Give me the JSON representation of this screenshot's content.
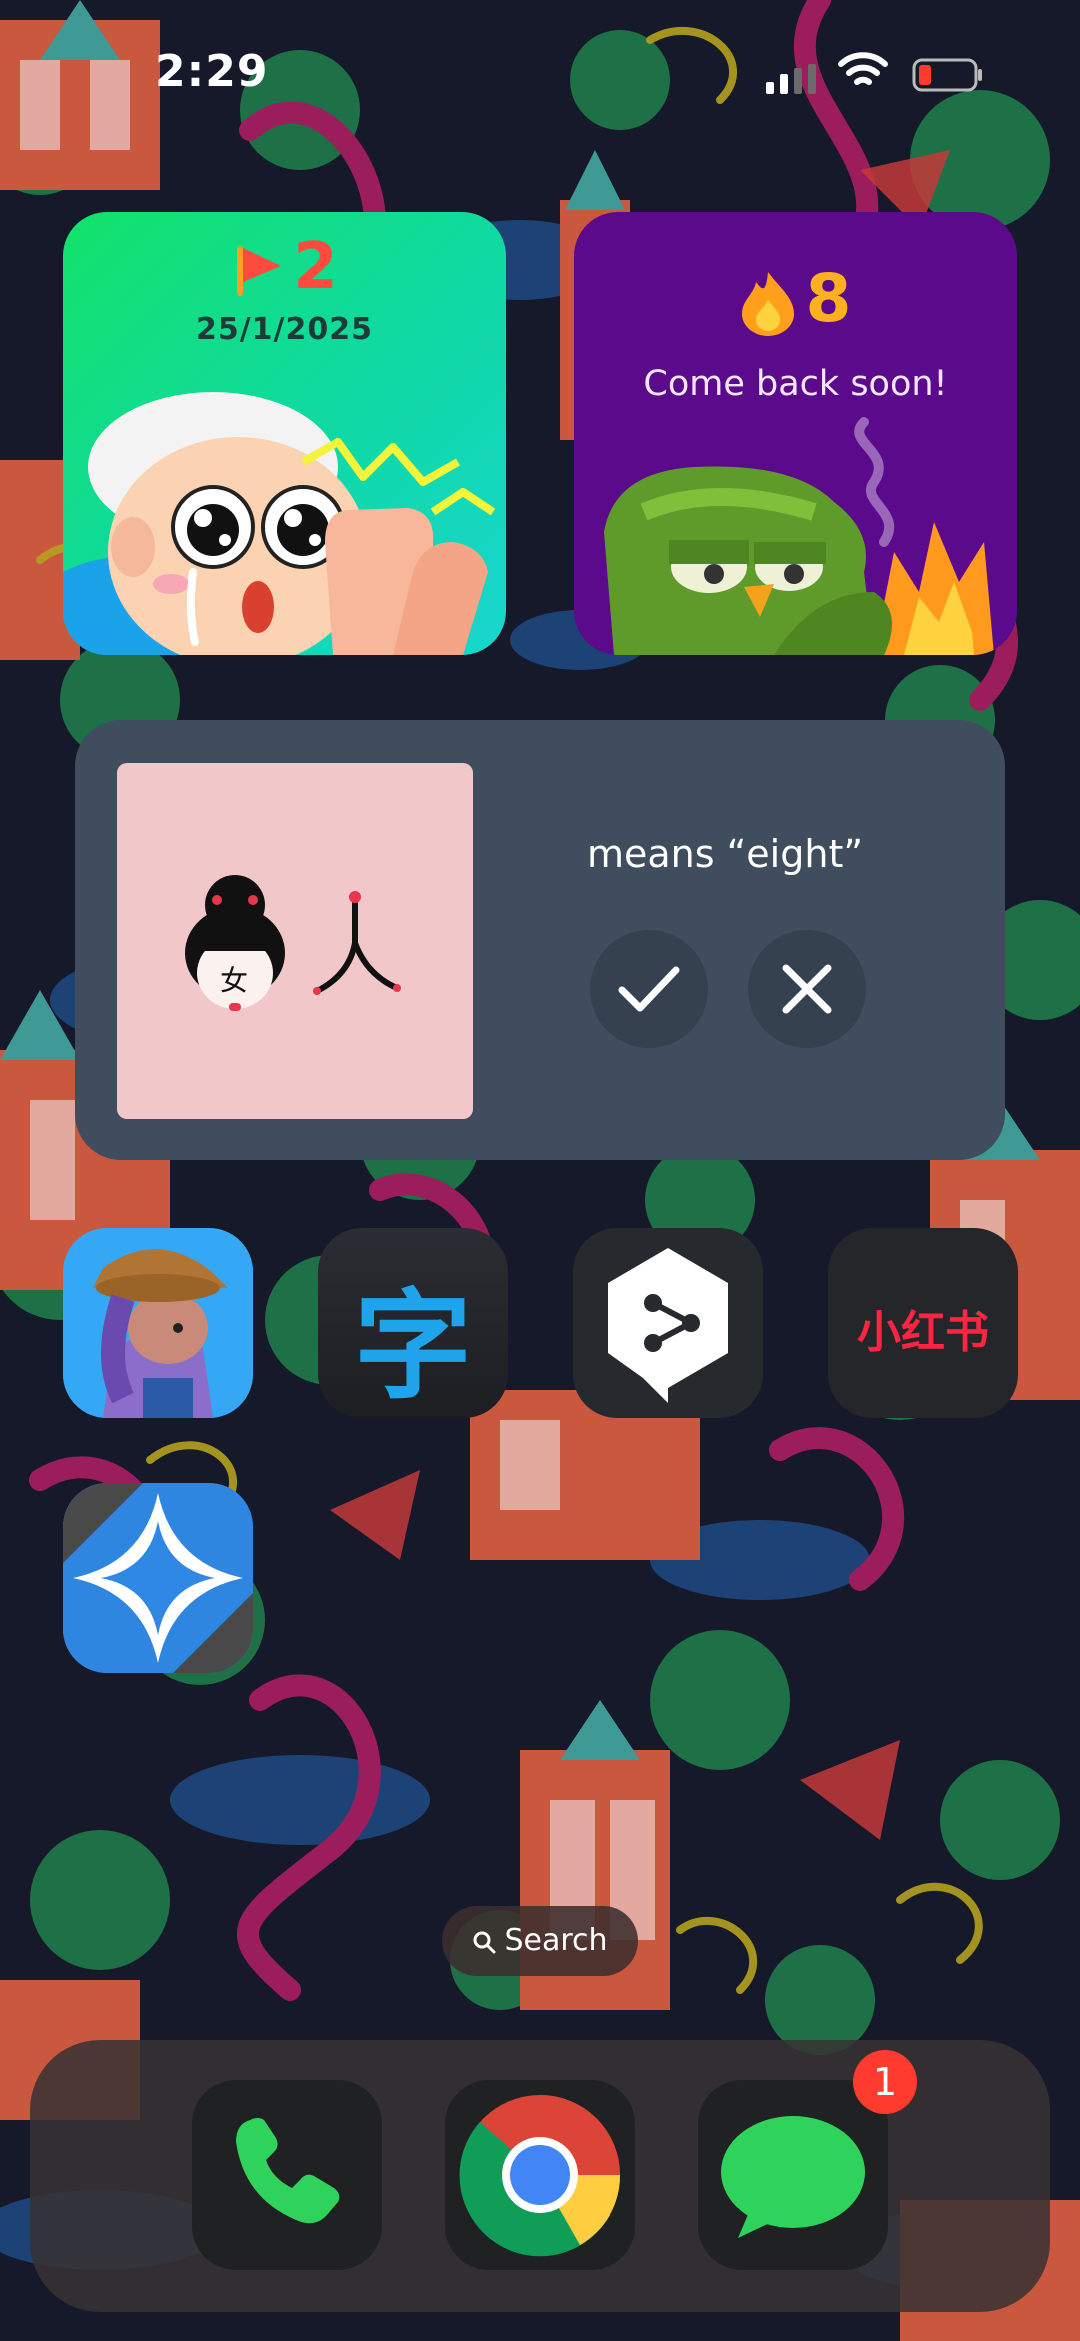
{
  "status_bar": {
    "time": "2:29"
  },
  "widgets": {
    "streak": {
      "count": "2",
      "date": "25/1/2025"
    },
    "fire": {
      "count": "8",
      "message": "Come back soon!"
    },
    "flashcard": {
      "character_left": "女",
      "prompt": "means “eight”"
    }
  },
  "apps": [
    {
      "name": "game-app"
    },
    {
      "name": "zi-character-app",
      "glyph": "字"
    },
    {
      "name": "deepl-app"
    },
    {
      "name": "xiaohongshu-app",
      "label": "小红书"
    },
    {
      "name": "star-app"
    }
  ],
  "search": {
    "label": "Search"
  },
  "dock": {
    "messages_badge": "1"
  },
  "colors": {
    "streak_red": "#ff4b3e",
    "fire_orange": "#ffb020",
    "fire_bg": "#5c0a8c",
    "flash_bg": "#3f4d5e",
    "card_pink": "#f2c7c9",
    "badge_red": "#ff3b30"
  }
}
